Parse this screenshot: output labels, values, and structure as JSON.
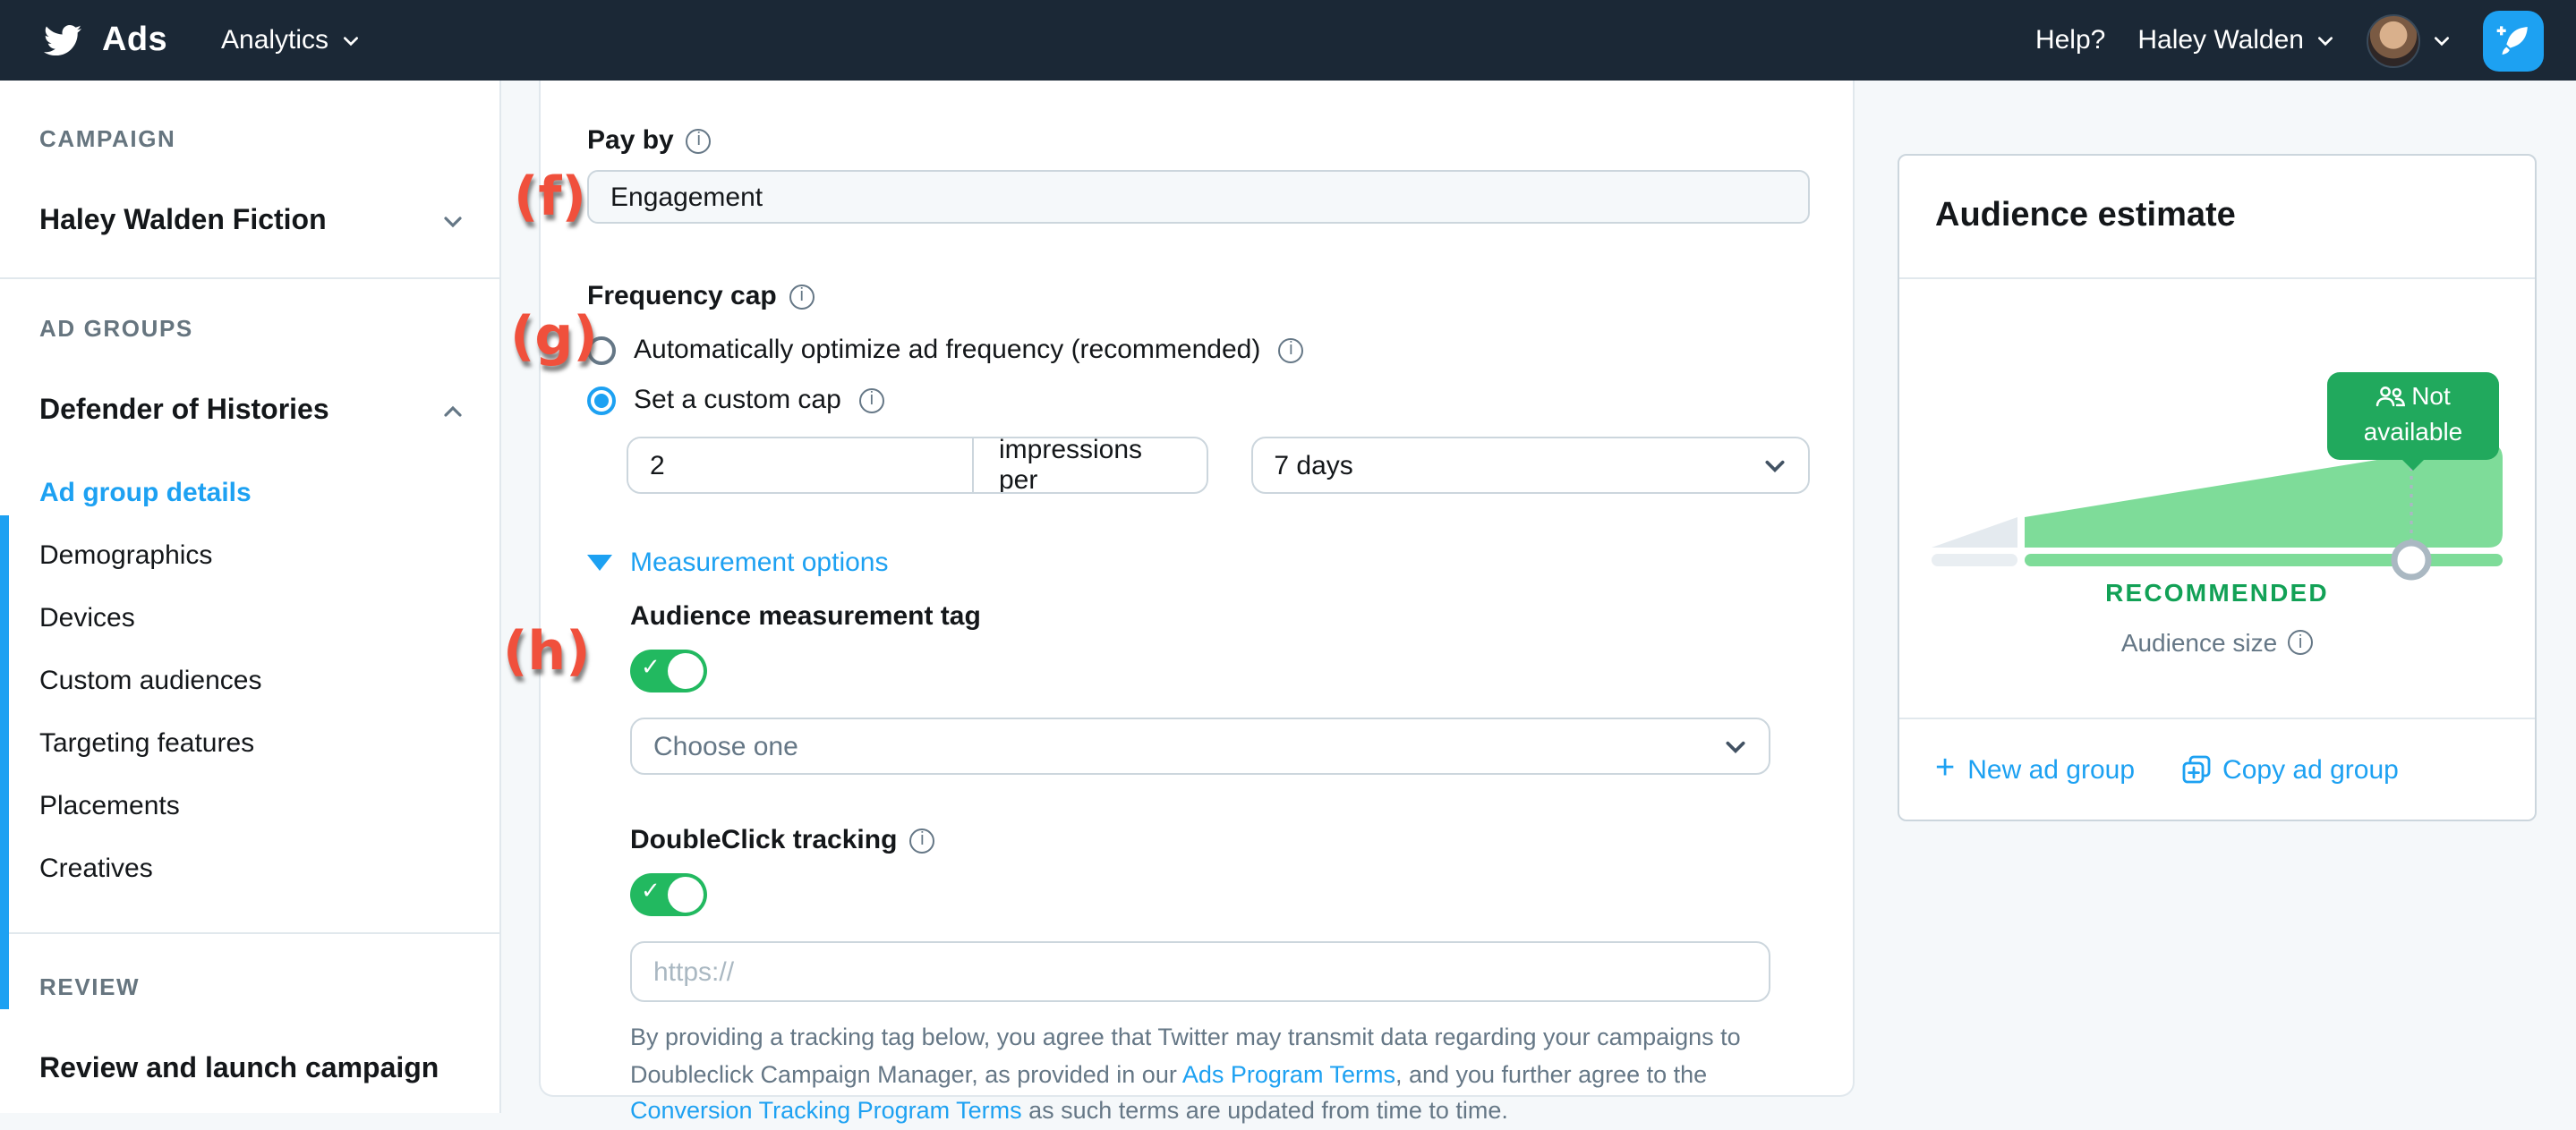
{
  "header": {
    "brand": "Ads",
    "nav_current": "Analytics",
    "help": "Help?",
    "user_name": "Haley Walden"
  },
  "sidebar": {
    "campaign_header": "CAMPAIGN",
    "campaign_name": "Haley Walden Fiction",
    "ad_groups_header": "AD GROUPS",
    "ad_group_name": "Defender of Histories",
    "items": [
      "Ad group details",
      "Demographics",
      "Devices",
      "Custom audiences",
      "Targeting features",
      "Placements",
      "Creatives"
    ],
    "review_header": "REVIEW",
    "review_item": "Review and launch campaign"
  },
  "main": {
    "pay_by": {
      "label": "Pay by",
      "value": "Engagement"
    },
    "frequency_cap": {
      "label": "Frequency cap",
      "option_auto": "Automatically optimize ad frequency (recommended)",
      "option_custom": "Set a custom cap",
      "cap_value": "2",
      "cap_unit": "impressions per",
      "cap_period": "7 days"
    },
    "measurement": {
      "section_label": "Measurement options",
      "audience_tag_label": "Audience measurement tag",
      "audience_tag_placeholder": "Choose one",
      "doubleclick_label": "DoubleClick tracking",
      "doubleclick_placeholder": "https://",
      "legal_part1": "By providing a tracking tag below, you agree that Twitter may transmit data regarding your campaigns to Doubleclick Campaign Manager, as provided in our ",
      "legal_link1": "Ads Program Terms",
      "legal_part2": ", and you further agree to the ",
      "legal_link2": "Conversion Tracking Program Terms",
      "legal_part3": " as such terms are updated from time to time."
    }
  },
  "aside": {
    "title": "Audience estimate",
    "tooltip": "Not available",
    "recommended": "RECOMMENDED",
    "audience_size_label": "Audience size",
    "new_ad_group": "New ad group",
    "copy_ad_group": "Copy ad group"
  },
  "annotations": {
    "f": "(f)",
    "g": "(g)",
    "h": "(h)"
  },
  "colors": {
    "accent_blue": "#1DA1F2",
    "header_bg": "#1B2836",
    "toggle_green": "#22B960",
    "tooltip_green": "#21A95D",
    "ramp_green": "#7EDC99",
    "recommended_green": "#12A156",
    "annotation_red": "#F0503C",
    "page_bg": "#F5F8FA"
  }
}
